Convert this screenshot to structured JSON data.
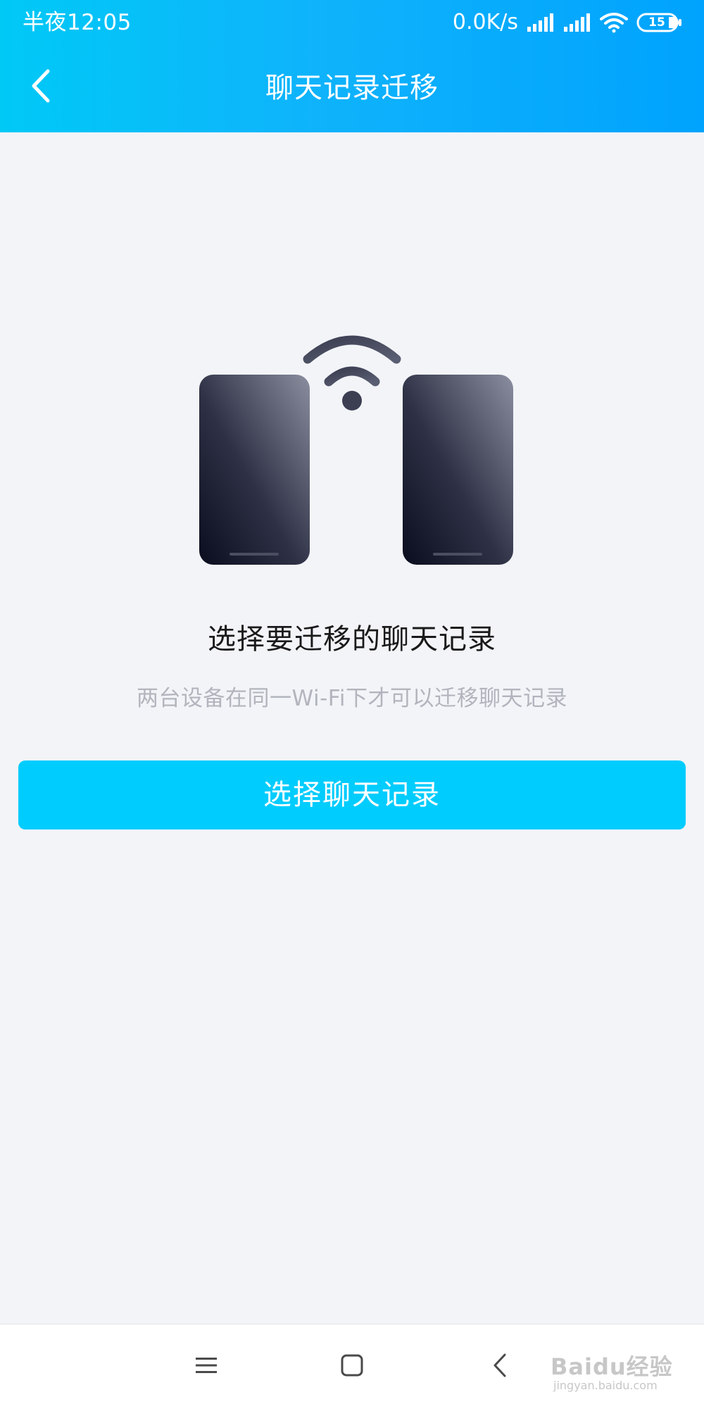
{
  "status_bar": {
    "time": "半夜12:05",
    "net_speed": "0.0K/s",
    "battery": "15",
    "icons": [
      "signal-icon",
      "signal-icon",
      "wifi-icon",
      "battery-icon"
    ]
  },
  "header": {
    "title": "聊天记录迁移",
    "back_icon": "chevron-left-icon"
  },
  "main": {
    "illustration": "two-phones-wifi-illustration",
    "heading": "选择要迁移的聊天记录",
    "subtext": "两台设备在同一Wi-Fi下才可以迁移聊天记录",
    "button_label": "选择聊天记录"
  },
  "nav_bar": {
    "items": [
      "menu-icon",
      "home-icon",
      "back-icon"
    ]
  },
  "watermark": {
    "text": "Baidu经验",
    "sub": "jingyan.baidu.com"
  },
  "colors": {
    "header_start": "#00c9f6",
    "header_end": "#00a3fd",
    "button": "#00ccfe",
    "background": "#f3f4f8",
    "subtext": "#b2b5bd"
  }
}
